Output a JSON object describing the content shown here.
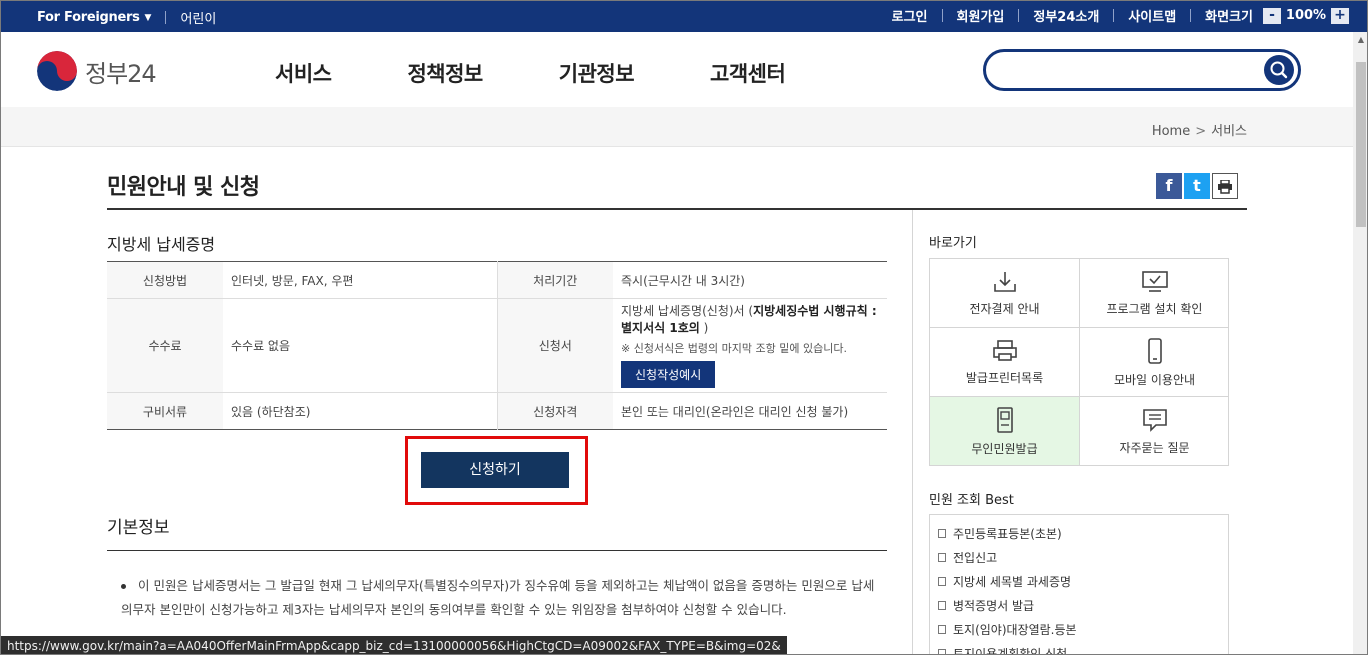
{
  "topbar": {
    "foreigners": "For Foreigners",
    "kids": "어린이",
    "login": "로그인",
    "signup": "회원가입",
    "about": "정부24소개",
    "sitemap": "사이트맵",
    "screen_size": "화면크기",
    "zoom_minus": "-",
    "zoom_value": "100%",
    "zoom_plus": "+"
  },
  "header": {
    "logo_text": "정부24",
    "menu": [
      "서비스",
      "정책정보",
      "기관정보",
      "고객센터"
    ],
    "search_placeholder": ""
  },
  "breadcrumb": {
    "home": "Home",
    "arrow": ">",
    "current": "서비스"
  },
  "page": {
    "title": "민원안내 및 신청",
    "share": {
      "facebook": "f",
      "twitter": "t"
    }
  },
  "service": {
    "name": "지방세 납세증명",
    "rows": [
      {
        "label1": "신청방법",
        "value1": "인터넷, 방문, FAX, 우편",
        "label2": "처리기간",
        "value2": "즉시(근무시간 내 3시간)"
      },
      {
        "label1": "수수료",
        "value1": "수수료 없음",
        "label2": "신청서"
      },
      {
        "label1": "구비서류",
        "value1": "있음 (하단참조)",
        "label2": "신청자격",
        "value2": "본인 또는 대리인(온라인은 대리인 신청 불가)"
      }
    ],
    "form": {
      "prefix": "지방세 납세증명(신청)서 (",
      "bold": "지방세징수법 시행규칙 : 별지서식 1호의",
      "suffix": " )",
      "note": "※ 신청서식은 법령의 마지막 조항 밑에 있습니다.",
      "example_button": "신청작성예시"
    },
    "apply_button": "신청하기"
  },
  "basic": {
    "title": "기본정보",
    "text": "이 민원은 납세증명서는 그 발급일 현재 그 납세의무자(특별징수의무자)가 징수유예 등을 제외하고는 체납액이 없음을 증명하는 민원으로 납세의무자 본인만이 신청가능하고 제3자는 납세의무자 본인의 동의여부를 확인할 수 있는 위임장을 첨부하여야 신청할 수 있습니다."
  },
  "quick": {
    "title": "바로가기",
    "items": [
      {
        "label": "전자결제 안내",
        "icon": "download-icon"
      },
      {
        "label": "프로그램 설치 확인",
        "icon": "monitor-check-icon"
      },
      {
        "label": "발급프린터목록",
        "icon": "printer-icon"
      },
      {
        "label": "모바일 이용안내",
        "icon": "mobile-icon"
      },
      {
        "label": "무인민원발급",
        "icon": "kiosk-icon"
      },
      {
        "label": "자주묻는 질문",
        "icon": "chat-icon"
      }
    ]
  },
  "best": {
    "title": "민원 조회 Best",
    "items": [
      "주민등록표등본(초본)",
      "전입신고",
      "지방세 세목별 과세증명",
      "병적증명서 발급",
      "토지(임야)대장열람.등본",
      "토지이용계획확인 신청"
    ]
  },
  "status_url": "https://www.gov.kr/main?a=AA040OfferMainFrmApp&capp_biz_cd=13100000056&HighCtgCD=A09002&FAX_TYPE=B&img=02&",
  "colors": {
    "navy": "#13357a",
    "red_highlight": "#e10a0a",
    "active_bg": "#e5f7e4"
  }
}
